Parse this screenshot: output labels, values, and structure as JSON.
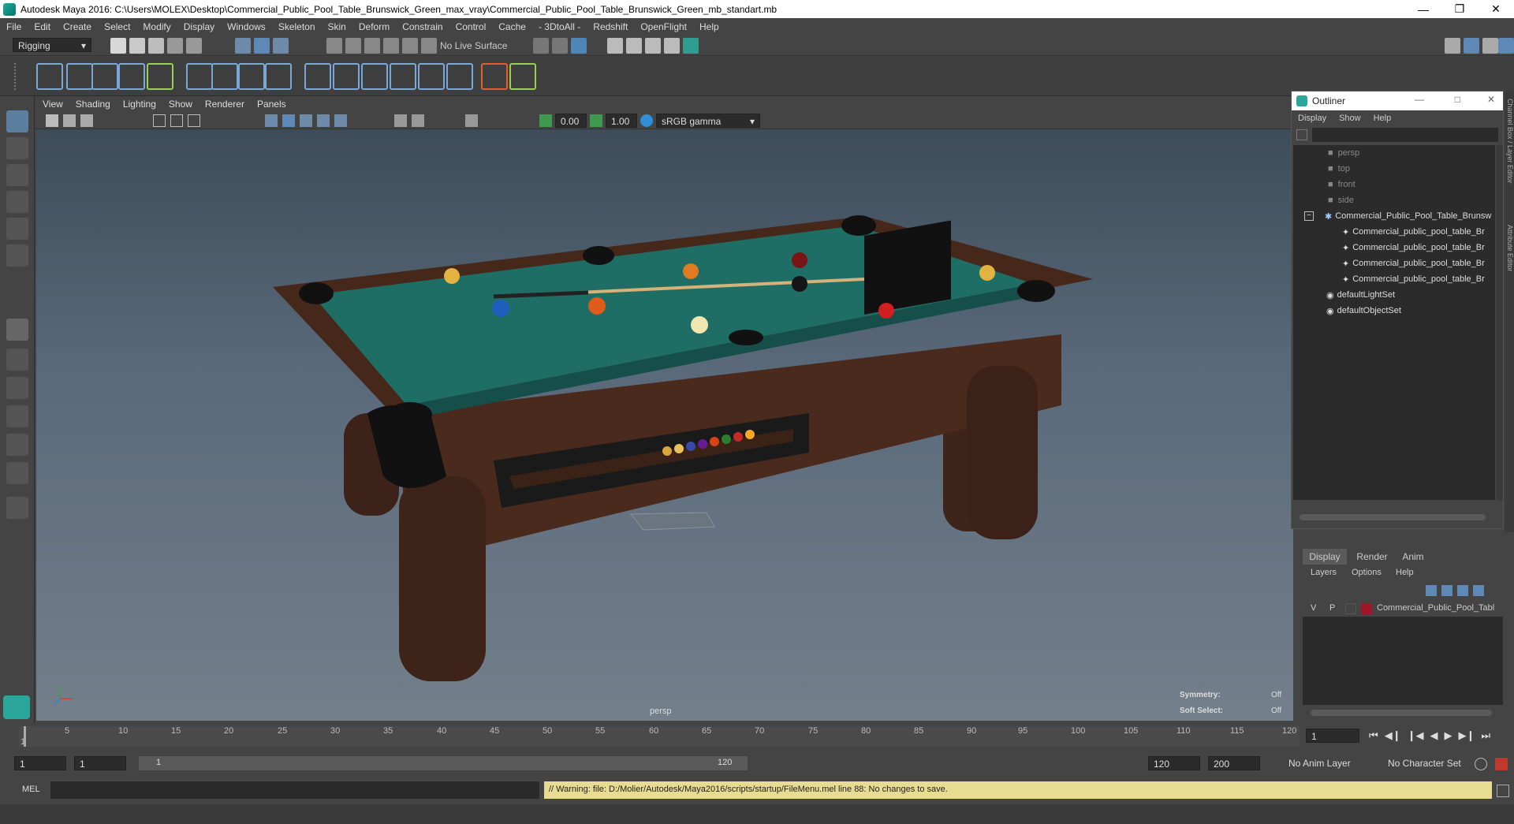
{
  "title": "Autodesk Maya 2016: C:\\Users\\MOLEX\\Desktop\\Commercial_Public_Pool_Table_Brunswick_Green_max_vray\\Commercial_Public_Pool_Table_Brunswick_Green_mb_standart.mb",
  "menu": [
    "File",
    "Edit",
    "Create",
    "Select",
    "Modify",
    "Display",
    "Windows",
    "Skeleton",
    "Skin",
    "Deform",
    "Constrain",
    "Control",
    "Cache",
    "- 3DtoAll -",
    "Redshift",
    "OpenFlight",
    "Help"
  ],
  "status": {
    "mode": "Rigging",
    "live_surface": "No Live Surface"
  },
  "panel_menu": [
    "View",
    "Shading",
    "Lighting",
    "Show",
    "Renderer",
    "Panels"
  ],
  "panel_toolbar": {
    "near": "0.00",
    "far": "1.00",
    "color_space": "sRGB gamma"
  },
  "viewport": {
    "camera_label": "persp",
    "symmetry_label": "Symmetry:",
    "symmetry_value": "Off",
    "soft_select_label": "Soft Select:",
    "soft_select_value": "Off"
  },
  "outliner": {
    "title": "Outliner",
    "menu": [
      "Display",
      "Show",
      "Help"
    ],
    "items": [
      {
        "label": "persp",
        "dim": true,
        "icon": "camera-icon"
      },
      {
        "label": "top",
        "dim": true,
        "icon": "camera-icon"
      },
      {
        "label": "front",
        "dim": true,
        "icon": "camera-icon"
      },
      {
        "label": "side",
        "dim": true,
        "icon": "camera-icon"
      },
      {
        "label": "Commercial_Public_Pool_Table_Brunsw",
        "dim": false,
        "icon": "group-icon"
      },
      {
        "label": "Commercial_public_pool_table_Br",
        "dim": false,
        "icon": "mesh-icon"
      },
      {
        "label": "Commercial_public_pool_table_Br",
        "dim": false,
        "icon": "mesh-icon"
      },
      {
        "label": "Commercial_public_pool_table_Br",
        "dim": false,
        "icon": "mesh-icon"
      },
      {
        "label": "Commercial_public_pool_table_Br",
        "dim": false,
        "icon": "mesh-icon"
      },
      {
        "label": "defaultLightSet",
        "dim": false,
        "icon": "set-icon"
      },
      {
        "label": "defaultObjectSet",
        "dim": false,
        "icon": "set-icon"
      }
    ]
  },
  "side_tabs": [
    "Channel Box / Layer Editor",
    "Attribute Editor"
  ],
  "layers": {
    "tabs": [
      "Display",
      "Render",
      "Anim"
    ],
    "menu": [
      "Layers",
      "Options",
      "Help"
    ],
    "row": {
      "v": "V",
      "p": "P",
      "name": "Commercial_Public_Pool_Tabl",
      "color": "#a01529"
    }
  },
  "timeline": {
    "ticks": [
      "5",
      "10",
      "15",
      "20",
      "25",
      "30",
      "35",
      "40",
      "45",
      "50",
      "55",
      "60",
      "65",
      "70",
      "75",
      "80",
      "85",
      "90",
      "95",
      "100",
      "105",
      "110",
      "115",
      "120"
    ],
    "first": "1",
    "current_frame": "1"
  },
  "range": {
    "start": "1",
    "start2": "1",
    "slider_start": "1",
    "slider_end": "120",
    "end": "120",
    "end2": "200",
    "anim_layer": "No Anim Layer",
    "char_set": "No Character Set"
  },
  "cmd": {
    "label": "MEL",
    "message": "// Warning: file: D:/Molier/Autodesk/Maya2016/scripts/startup/FileMenu.mel line 88: No changes to save."
  },
  "colors": {
    "felt": "#1e6e66",
    "wood": "#4a2a1c",
    "accent_icon": "#2f8fd8",
    "warning_bg": "#e8dc92"
  }
}
